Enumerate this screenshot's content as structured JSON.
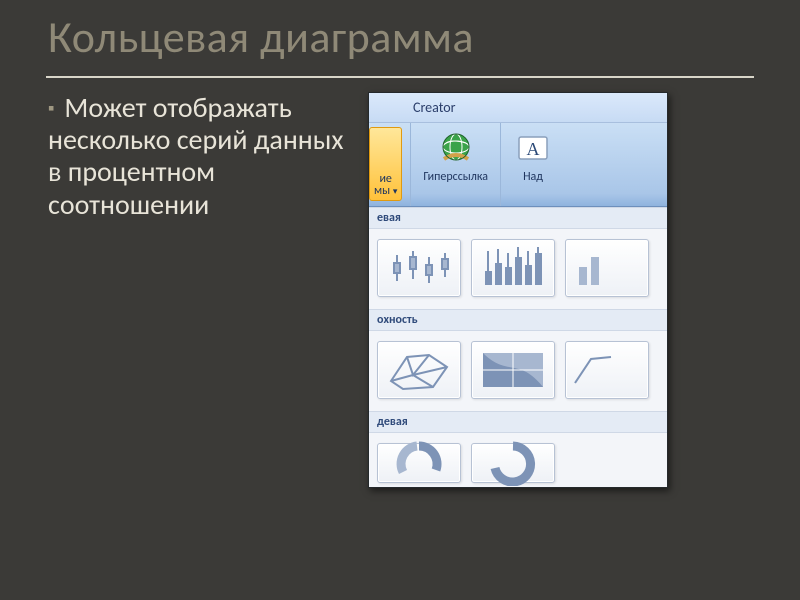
{
  "slide": {
    "title": "Кольцевая диаграмма",
    "bullet": "Может отображать несколько серий данных в процентном соотношении"
  },
  "ribbon": {
    "header_label": "Creator",
    "chart_button": {
      "line1": "ие",
      "line2": "мы"
    },
    "hyperlink_button": "Гиперссылка",
    "textbox_button": "Над"
  },
  "gallery": {
    "section_stock": "евая",
    "section_surface": "охность",
    "section_doughnut": "девая"
  }
}
